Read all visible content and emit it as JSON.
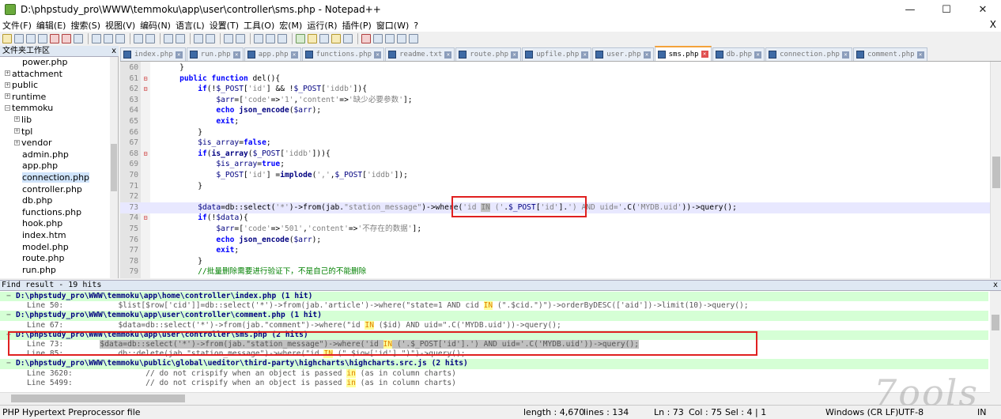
{
  "window": {
    "title": "D:\\phpstudy_pro\\WWW\\temmoku\\app\\user\\controller\\sms.php - Notepad++",
    "minimize": "—",
    "maximize": "☐",
    "close": "✕"
  },
  "menu": {
    "items": [
      "文件(F)",
      "编辑(E)",
      "搜索(S)",
      "视图(V)",
      "编码(N)",
      "语言(L)",
      "设置(T)",
      "工具(O)",
      "宏(M)",
      "运行(R)",
      "插件(P)",
      "窗口(W)",
      "?"
    ],
    "close": "X"
  },
  "workspace": {
    "title": "文件夹工作区",
    "close": "x",
    "items": [
      {
        "label": "power.php",
        "indent": 2,
        "expander": ""
      },
      {
        "label": "attachment",
        "indent": 1,
        "expander": "+"
      },
      {
        "label": "public",
        "indent": 1,
        "expander": "+"
      },
      {
        "label": "runtime",
        "indent": 1,
        "expander": "+"
      },
      {
        "label": "temmoku",
        "indent": 1,
        "expander": "−"
      },
      {
        "label": "lib",
        "indent": 2,
        "expander": "+"
      },
      {
        "label": "tpl",
        "indent": 2,
        "expander": "+"
      },
      {
        "label": "vendor",
        "indent": 2,
        "expander": "+"
      },
      {
        "label": "admin.php",
        "indent": 2,
        "expander": ""
      },
      {
        "label": "app.php",
        "indent": 2,
        "expander": ""
      },
      {
        "label": "connection.php",
        "indent": 2,
        "expander": "",
        "selected": true
      },
      {
        "label": "controller.php",
        "indent": 2,
        "expander": ""
      },
      {
        "label": "db.php",
        "indent": 2,
        "expander": ""
      },
      {
        "label": "functions.php",
        "indent": 2,
        "expander": ""
      },
      {
        "label": "hook.php",
        "indent": 2,
        "expander": ""
      },
      {
        "label": "index.htm",
        "indent": 2,
        "expander": ""
      },
      {
        "label": "model.php",
        "indent": 2,
        "expander": ""
      },
      {
        "label": "route.php",
        "indent": 2,
        "expander": ""
      },
      {
        "label": "run.php",
        "indent": 2,
        "expander": ""
      }
    ]
  },
  "tabs": [
    {
      "label": "index.php",
      "active": false
    },
    {
      "label": "run.php",
      "active": false
    },
    {
      "label": "app.php",
      "active": false
    },
    {
      "label": "functions.php",
      "active": false
    },
    {
      "label": "readme.txt",
      "active": false
    },
    {
      "label": "route.php",
      "active": false
    },
    {
      "label": "upfile.php",
      "active": false
    },
    {
      "label": "user.php",
      "active": false
    },
    {
      "label": "sms.php",
      "active": true
    },
    {
      "label": "db.php",
      "active": false
    },
    {
      "label": "connection.php",
      "active": false
    },
    {
      "label": "comment.php",
      "active": false
    }
  ],
  "code_lines": [
    {
      "n": "60",
      "fold": "",
      "html": "    }"
    },
    {
      "n": "61",
      "fold": "⊟",
      "html": "    <span class=\"kw\">public function</span> del(){"
    },
    {
      "n": "62",
      "fold": "⊟",
      "html": "        <span class=\"kw\">if</span>(!<span class=\"var\">$_POST</span>[<span class=\"str\">'id'</span>] &amp;&amp; !<span class=\"var\">$_POST</span>[<span class=\"str\">'iddb'</span>]){"
    },
    {
      "n": "63",
      "fold": "",
      "html": "            <span class=\"var\">$arr</span>=[<span class=\"str\">'code'</span>=&gt;<span class=\"str\">'1'</span>,<span class=\"str\">'content'</span>=&gt;<span class=\"str\">'缺少必要参数'</span>];"
    },
    {
      "n": "64",
      "fold": "",
      "html": "            <span class=\"kw\">echo</span> <span class=\"fnm\">json_encode</span>(<span class=\"var\">$arr</span>);"
    },
    {
      "n": "65",
      "fold": "",
      "html": "            <span class=\"kw\">exit</span>;"
    },
    {
      "n": "66",
      "fold": "",
      "html": "        }"
    },
    {
      "n": "67",
      "fold": "",
      "html": "        <span class=\"var\">$is_array</span>=<span class=\"kw\">false</span>;"
    },
    {
      "n": "68",
      "fold": "⊟",
      "html": "        <span class=\"kw\">if</span>(<span class=\"fnm\">is_array</span>(<span class=\"var\">$_POST</span>[<span class=\"str\">'iddb'</span>])){"
    },
    {
      "n": "69",
      "fold": "",
      "html": "            <span class=\"var\">$is_array</span>=<span class=\"kw\">true</span>;"
    },
    {
      "n": "70",
      "fold": "",
      "html": "            <span class=\"var\">$_POST</span>[<span class=\"str\">'id'</span>] =<span class=\"fnm\">implode</span>(<span class=\"str\">','</span>,<span class=\"var\">$_POST</span>[<span class=\"str\">'iddb'</span>]);"
    },
    {
      "n": "71",
      "fold": "",
      "html": "        }"
    },
    {
      "n": "72",
      "fold": "",
      "html": ""
    },
    {
      "n": "73",
      "fold": "",
      "html": "        <span class=\"var\">$data</span>=db::select(<span class=\"str\">'*'</span>)-&gt;from(jab.<span class=\"str\">\"station_message\"</span>)-&gt;where(<span class=\"str\">'id <span style=\"background:#c0c0c0\">IN</span> ('</span>.<span class=\"var\">$_POST</span>[<span class=\"str\">'id'</span>].<span class=\"str\">') AND uid='</span>.C(<span class=\"str\">'MYDB.uid'</span>))-&gt;query();",
      "highlight": true
    },
    {
      "n": "74",
      "fold": "⊟",
      "html": "        <span class=\"kw\">if</span>(!<span class=\"var\">$data</span>){"
    },
    {
      "n": "75",
      "fold": "",
      "html": "            <span class=\"var\">$arr</span>=[<span class=\"str\">'code'</span>=&gt;<span class=\"str\">'501'</span>,<span class=\"str\">'content'</span>=&gt;<span class=\"str\">'不存在的数据'</span>];"
    },
    {
      "n": "76",
      "fold": "",
      "html": "            <span class=\"kw\">echo</span> <span class=\"fnm\">json_encode</span>(<span class=\"var\">$arr</span>);"
    },
    {
      "n": "77",
      "fold": "",
      "html": "            <span class=\"kw\">exit</span>;"
    },
    {
      "n": "78",
      "fold": "",
      "html": "        }"
    },
    {
      "n": "79",
      "fold": "",
      "html": "        <span class=\"cmt\">//批量删除需要进行验证下，不是自己的不能删除</span>"
    }
  ],
  "find": {
    "header": "Find result - 19 hits",
    "close": "x",
    "rows": [
      {
        "type": "file",
        "text": "D:\\phpstudy_pro\\WWW\\temmoku\\app\\home\\controller\\index.php (1 hit)"
      },
      {
        "type": "line",
        "html": "Line 50:            $list[$row['cid']]=db::select('*')-&gt;from(jab.'article')-&gt;where(\"state=1 AND cid <span class=\"hit\">IN</span> (\".$cid.\")\")-&gt;orderByDESC(['aid'])-&gt;limit(10)-&gt;query();"
      },
      {
        "type": "file",
        "text": "D:\\phpstudy_pro\\WWW\\temmoku\\app\\user\\controller\\comment.php (1 hit)"
      },
      {
        "type": "line",
        "html": "Line 67:            $data=db::select('*')-&gt;from(jab.\"comment\")-&gt;where(\"id <span class=\"hit\">IN</span> ($id) AND uid=\".C('MYDB.uid'))-&gt;query();"
      },
      {
        "type": "file",
        "text": "D:\\phpstudy_pro\\WWW\\temmoku\\app\\user\\controller\\sms.php (2 hits)"
      },
      {
        "type": "line",
        "cur": true,
        "html": "Line 73:        <span class=\"sel\">$data=db::select('*')-&gt;from(jab.\"station_message\")-&gt;where('id <span class=\"hit\">IN</span> ('.$_POST['id'].') AND uid='.C('MYDB.uid'))-&gt;query();</span>"
      },
      {
        "type": "line",
        "html": "Line 85:            db::delete(jab.\"station_message\")-&gt;where(\"id <span class=\"hit\">IN</span> (\".$iow['id'].\")\")-&gt;query();"
      },
      {
        "type": "file",
        "text": "D:\\phpstudy_pro\\WWW\\temmoku\\public\\global\\ueditor\\third-party\\highcharts\\highcharts.src.js (2 hits)"
      },
      {
        "type": "line",
        "html": "Line 3620:                // do not crispify when an object is passed <span class=\"hit\">in</span> (as in column charts)"
      },
      {
        "type": "line",
        "html": "Line 5499:                // do not crispify when an object is passed <span class=\"hit\">in</span> (as in column charts)"
      }
    ]
  },
  "watermark": "7ools",
  "status": {
    "filetype": "PHP Hypertext Preprocessor file",
    "length": "length : 4,670",
    "lines": "lines : 134",
    "ln": "Ln : 73",
    "col": "Col : 75",
    "sel": "Sel : 4 | 1",
    "eol": "Windows (CR LF)",
    "encoding": "UTF-8",
    "mode": "IN"
  }
}
